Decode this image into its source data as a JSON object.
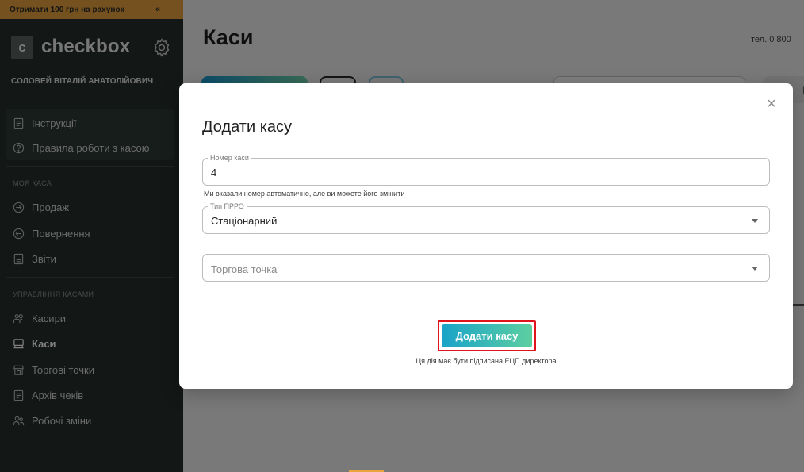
{
  "sidebar": {
    "promo": "Отримати 100 грн на рахунок",
    "promo_collapse": "«",
    "logo_letter": "c",
    "logo_text": "checkbox",
    "owner": "СОЛОВЕЙ ВІТАЛІЙ АНАТОЛІЙОВИЧ",
    "help_items": [
      {
        "label": "Інструкції",
        "icon": "document-icon"
      },
      {
        "label": "Правила роботи з касою",
        "icon": "question-circle-icon"
      }
    ],
    "section_my": "МОЯ КАСА",
    "my_items": [
      {
        "label": "Продаж",
        "icon": "arrow-in-circle-icon"
      },
      {
        "label": "Повернення",
        "icon": "arrow-back-circle-icon"
      },
      {
        "label": "Звіти",
        "icon": "report-icon"
      }
    ],
    "section_manage": "УПРАВЛІННЯ КАСАМИ",
    "manage_items": [
      {
        "label": "Касири",
        "icon": "cashiers-icon"
      },
      {
        "label": "Каси",
        "icon": "register-icon",
        "active": true
      },
      {
        "label": "Торгові точки",
        "icon": "store-icon"
      },
      {
        "label": "Архів чеків",
        "icon": "archive-icon"
      },
      {
        "label": "Робочі зміни",
        "icon": "shifts-icon"
      }
    ]
  },
  "main": {
    "title": "Каси",
    "phone": "тел. 0 800",
    "filter_partial": "По"
  },
  "modal": {
    "title": "Додати касу",
    "close_label": "×",
    "register_number": {
      "legend": "Номер каси",
      "value": "4"
    },
    "helper": "Ми вказали номер автоматично, але ви можете його змінити",
    "prro_type": {
      "legend": "Тип ПРРО",
      "value": "Стаціонарний"
    },
    "trade_point": {
      "placeholder": "Торгова точка"
    },
    "submit_label": "Додати касу",
    "note": "Ця дія має бути підписана ЕЦП директора"
  },
  "colors": {
    "sidebar_bg": "#262e2c",
    "promo_bg": "#e8a33c",
    "accent_gradient_start": "#1aa3c9",
    "accent_gradient_end": "#5ccfa0",
    "highlight_border": "#e0141c"
  }
}
